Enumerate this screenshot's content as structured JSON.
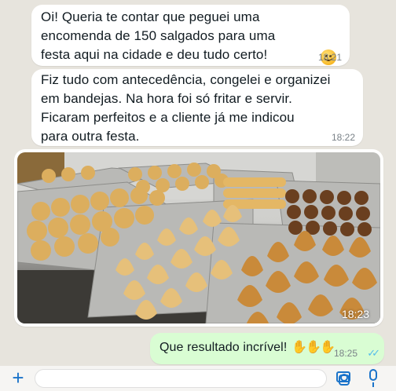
{
  "messages": [
    {
      "text": "Oi! Queria te contar que peguei uma\nencomenda de 150 salgados para uma\nfesta aqui na cidade e deu tudo certo!",
      "emoji": "smiling-face",
      "time": "18:21",
      "direction": "incoming"
    },
    {
      "text": "Fiz tudo com antecedência, congelei e organizei\nem bandejas. Na hora foi só fritar e servir.\nFicaram perfeitos e a cliente já me indicou\npara outra festa.",
      "time": "18:22",
      "direction": "incoming"
    },
    {
      "image": "trays-of-salgados-photo",
      "time": "18:23",
      "direction": "incoming"
    },
    {
      "text": "Que resultado incrível!",
      "emoji": "clapping-hands x3",
      "time": "18:25",
      "status": "read",
      "direction": "outgoing"
    }
  ],
  "composer": {
    "placeholder": "",
    "icons": [
      "plus-icon",
      "sticker-icon",
      "camera-icon",
      "microphone-icon"
    ]
  },
  "colors": {
    "background": "#e7e4dd",
    "incoming_bubble": "#ffffff",
    "outgoing_bubble": "#d9fdd3",
    "accent": "#1a73c9",
    "read_ticks": "#53bdeb"
  }
}
